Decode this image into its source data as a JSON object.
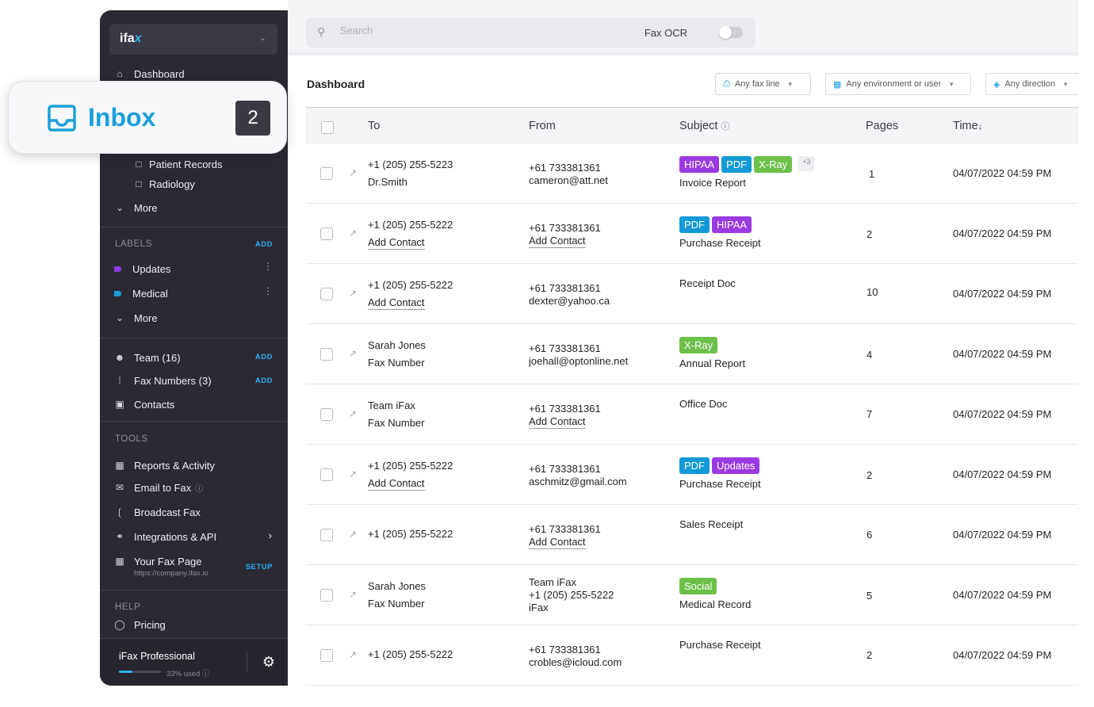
{
  "sidebar": {
    "brand": {
      "logo_text": "ifa",
      "logo_accent": "x"
    },
    "dashboard_label": "Dashboard",
    "folders": [
      {
        "label": "Patient Records"
      },
      {
        "label": "Radiology"
      }
    ],
    "more_label": "More",
    "labels_heading": "LABELS",
    "add_label": "ADD",
    "labels": [
      {
        "label": "Updates",
        "color": "#8e3ce6"
      },
      {
        "label": "Medical",
        "color": "#1a9fd8"
      }
    ],
    "labels_more": "More",
    "team": "Team (16)",
    "fax_numbers": "Fax Numbers (3)",
    "contacts": "Contacts",
    "tools_heading": "TOOLS",
    "tools": {
      "reports": "Reports & Activity",
      "email_to_fax": "Email to Fax",
      "broadcast": "Broadcast Fax",
      "integrations": "Integrations & API",
      "fax_page": "Your Fax Page",
      "fax_page_url": "https://company.ifax.io",
      "setup": "SETUP"
    },
    "help_heading": "HELP",
    "pricing": "Pricing",
    "plan": "iFax Professional",
    "usage_text": "33% used",
    "usage_fraction": 0.33
  },
  "inbox_card": {
    "label": "Inbox",
    "count": "2"
  },
  "topbar": {
    "search_placeholder": "Search",
    "fax_ocr_label": "Fax OCR",
    "fax_ocr_enabled": false
  },
  "page_title": "Dashboard",
  "filters": {
    "fax_line": "Any fax line",
    "environment": "Any environment or user",
    "direction": "Any direction"
  },
  "table": {
    "headers": {
      "to": "To",
      "from": "From",
      "subject": "Subject",
      "pages": "Pages",
      "time": "Time"
    },
    "rows": [
      {
        "to1": "+1 (205) 255-5223",
        "to2": "Dr.Smith",
        "from1": "+61 733381361",
        "from2": "cameron@att.net",
        "tags": [
          "HIPAA",
          "PDF",
          "X-Ray"
        ],
        "more_tags": "+3",
        "subject": "Invoice Report",
        "pages": "1",
        "time": "04/07/2022 04:59 PM"
      },
      {
        "to1": "+1 (205) 255-5222",
        "to2": "Add Contact",
        "from1": "+61 733381361",
        "from2": "Add Contact",
        "tags": [
          "PDF",
          "HIPAA"
        ],
        "subject": "Purchase Receipt",
        "pages": "2",
        "time": "04/07/2022 04:59 PM"
      },
      {
        "to1": "+1 (205) 255-5222",
        "to2": "Add Contact",
        "from1": "+61 733381361",
        "from2": "dexter@yahoo.ca",
        "tags": [],
        "subject": "Receipt Doc",
        "pages": "10",
        "time": "04/07/2022 04:59 PM"
      },
      {
        "to1": "Sarah Jones",
        "to2": "Fax Number",
        "from1": "+61 733381361",
        "from2": "joehall@optonline.net",
        "tags": [
          "X-Ray"
        ],
        "subject": "Annual Report",
        "pages": "4",
        "time": "04/07/2022 04:59 PM"
      },
      {
        "to1": "Team iFax",
        "to2": "Fax Number",
        "from1": "+61 733381361",
        "from2": "Add Contact",
        "tags": [],
        "subject": "Office Doc",
        "pages": "7",
        "time": "04/07/2022 04:59 PM"
      },
      {
        "to1": "+1 (205) 255-5222",
        "to2": "Add Contact",
        "from1": "+61 733381361",
        "from2": "aschmitz@gmail.com",
        "tags": [
          "PDF",
          "Updates"
        ],
        "subject": "Purchase Receipt",
        "pages": "2",
        "time": "04/07/2022 04:59 PM"
      },
      {
        "to1": "+1 (205) 255-5222",
        "to2": "",
        "from1": "+61 733381361",
        "from2": "Add Contact",
        "tags": [],
        "subject": "Sales Receipt",
        "pages": "6",
        "time": "04/07/2022 04:59 PM"
      },
      {
        "to1": "Sarah Jones",
        "to2": "Fax Number",
        "from1": "Team iFax",
        "from2": "+1 (205) 255-5222",
        "from3": "iFax",
        "tags": [
          "Social"
        ],
        "subject": "Medical Record",
        "pages": "5",
        "time": "04/07/2022 04:59 PM"
      },
      {
        "to1": "+1 (205) 255-5222",
        "to2": "",
        "from1": "+61 733381361",
        "from2": "crobles@icloud.com",
        "tags": [],
        "subject": "Purchase Receipt",
        "pages": "2",
        "time": "04/07/2022 04:59 PM"
      }
    ]
  },
  "tag_colors": {
    "HIPAA": "#9b3ae0",
    "PDF": "#139ad6",
    "X-Ray": "#6cc04a",
    "Updates": "#9b3ae0",
    "Social": "#6cc04a"
  }
}
